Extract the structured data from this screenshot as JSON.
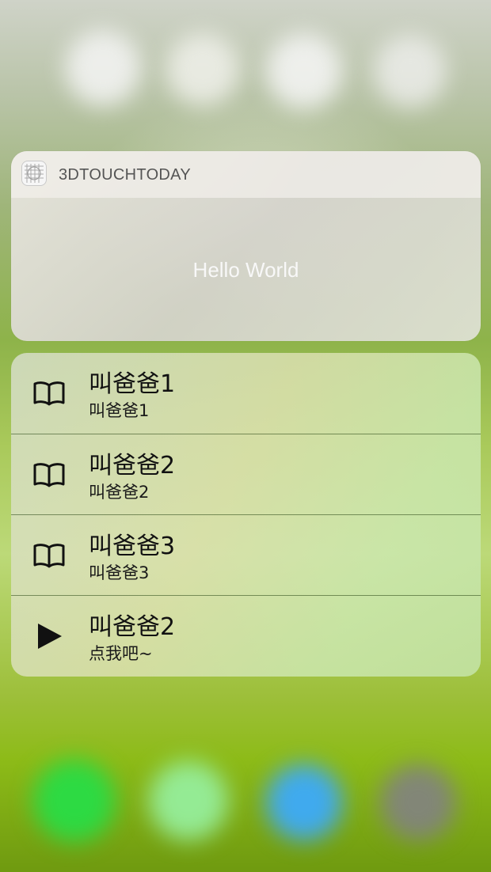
{
  "widget": {
    "app_name": "3DTOUCHTODAY",
    "app_icon": "grid-app-icon",
    "content_text": "Hello World"
  },
  "quick_actions": [
    {
      "title": "叫爸爸1",
      "subtitle": "叫爸爸1",
      "icon": "book-icon"
    },
    {
      "title": "叫爸爸2",
      "subtitle": "叫爸爸2",
      "icon": "book-icon"
    },
    {
      "title": "叫爸爸3",
      "subtitle": "叫爸爸3",
      "icon": "book-icon"
    },
    {
      "title": "叫爸爸2",
      "subtitle": "点我吧~",
      "icon": "play-icon"
    }
  ],
  "colors": {
    "item_text": "#111111",
    "widget_text": "#f8f8f8",
    "header_text": "#555555"
  }
}
